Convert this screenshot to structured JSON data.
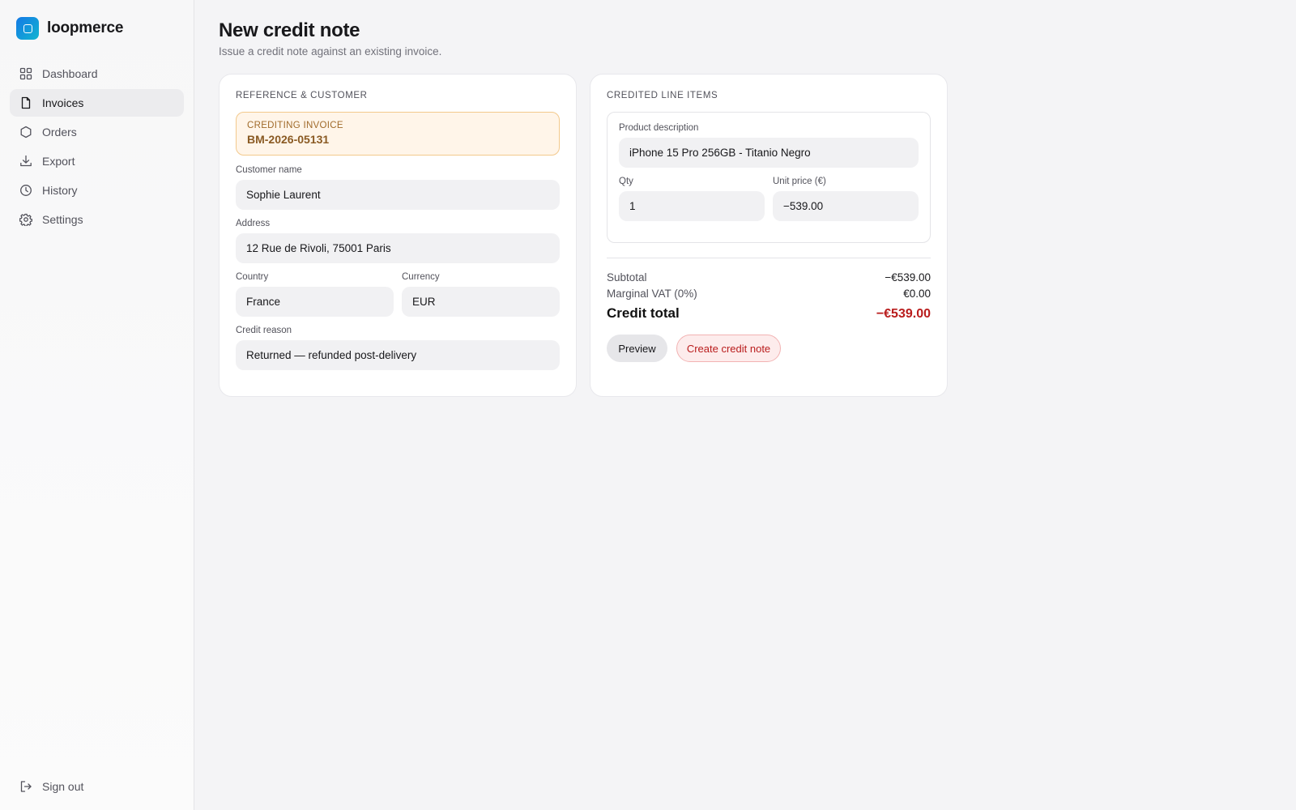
{
  "brand": {
    "name": "loopmerce",
    "accent": "#1479e6"
  },
  "sidebar": {
    "items": [
      {
        "label": "Dashboard",
        "icon": "grid-icon",
        "active": false
      },
      {
        "label": "Invoices",
        "icon": "file-icon",
        "active": true
      },
      {
        "label": "Orders",
        "icon": "box-icon",
        "active": false
      },
      {
        "label": "Export",
        "icon": "download-icon",
        "active": false
      },
      {
        "label": "History",
        "icon": "clock-icon",
        "active": false
      },
      {
        "label": "Settings",
        "icon": "gear-icon",
        "active": false
      }
    ],
    "signout": {
      "label": "Sign out",
      "icon": "logout-icon"
    }
  },
  "header": {
    "title": "New credit note",
    "subtitle": "Issue a credit note against an existing invoice."
  },
  "reference": {
    "section_title": "REFERENCE & CUSTOMER",
    "crediting_label": "CREDITING INVOICE",
    "crediting_value": "BM-2026-05131",
    "customer_name_label": "Customer name",
    "customer_name": "Sophie Laurent",
    "address_label": "Address",
    "address": "12 Rue de Rivoli, 75001 Paris",
    "country_label": "Country",
    "country": "France",
    "currency_label": "Currency",
    "currency": "EUR",
    "reason_label": "Credit reason",
    "reason": "Returned — refunded post-delivery"
  },
  "line_items": {
    "section_title": "CREDITED LINE ITEMS",
    "description_label": "Product description",
    "description": "iPhone 15 Pro 256GB - Titanio Negro",
    "qty_label": "Qty",
    "qty": "1",
    "unit_price_label": "Unit price (€)",
    "unit_price": "−539.00"
  },
  "summary": {
    "subtotal_label": "Subtotal",
    "subtotal": "−€539.00",
    "vat_label": "Marginal VAT (0%)",
    "vat": "€0.00",
    "total_label": "Credit total",
    "total": "−€539.00",
    "total_color": "#b91c1c"
  },
  "actions": {
    "preview_label": "Preview",
    "create_label": "Create credit note"
  }
}
